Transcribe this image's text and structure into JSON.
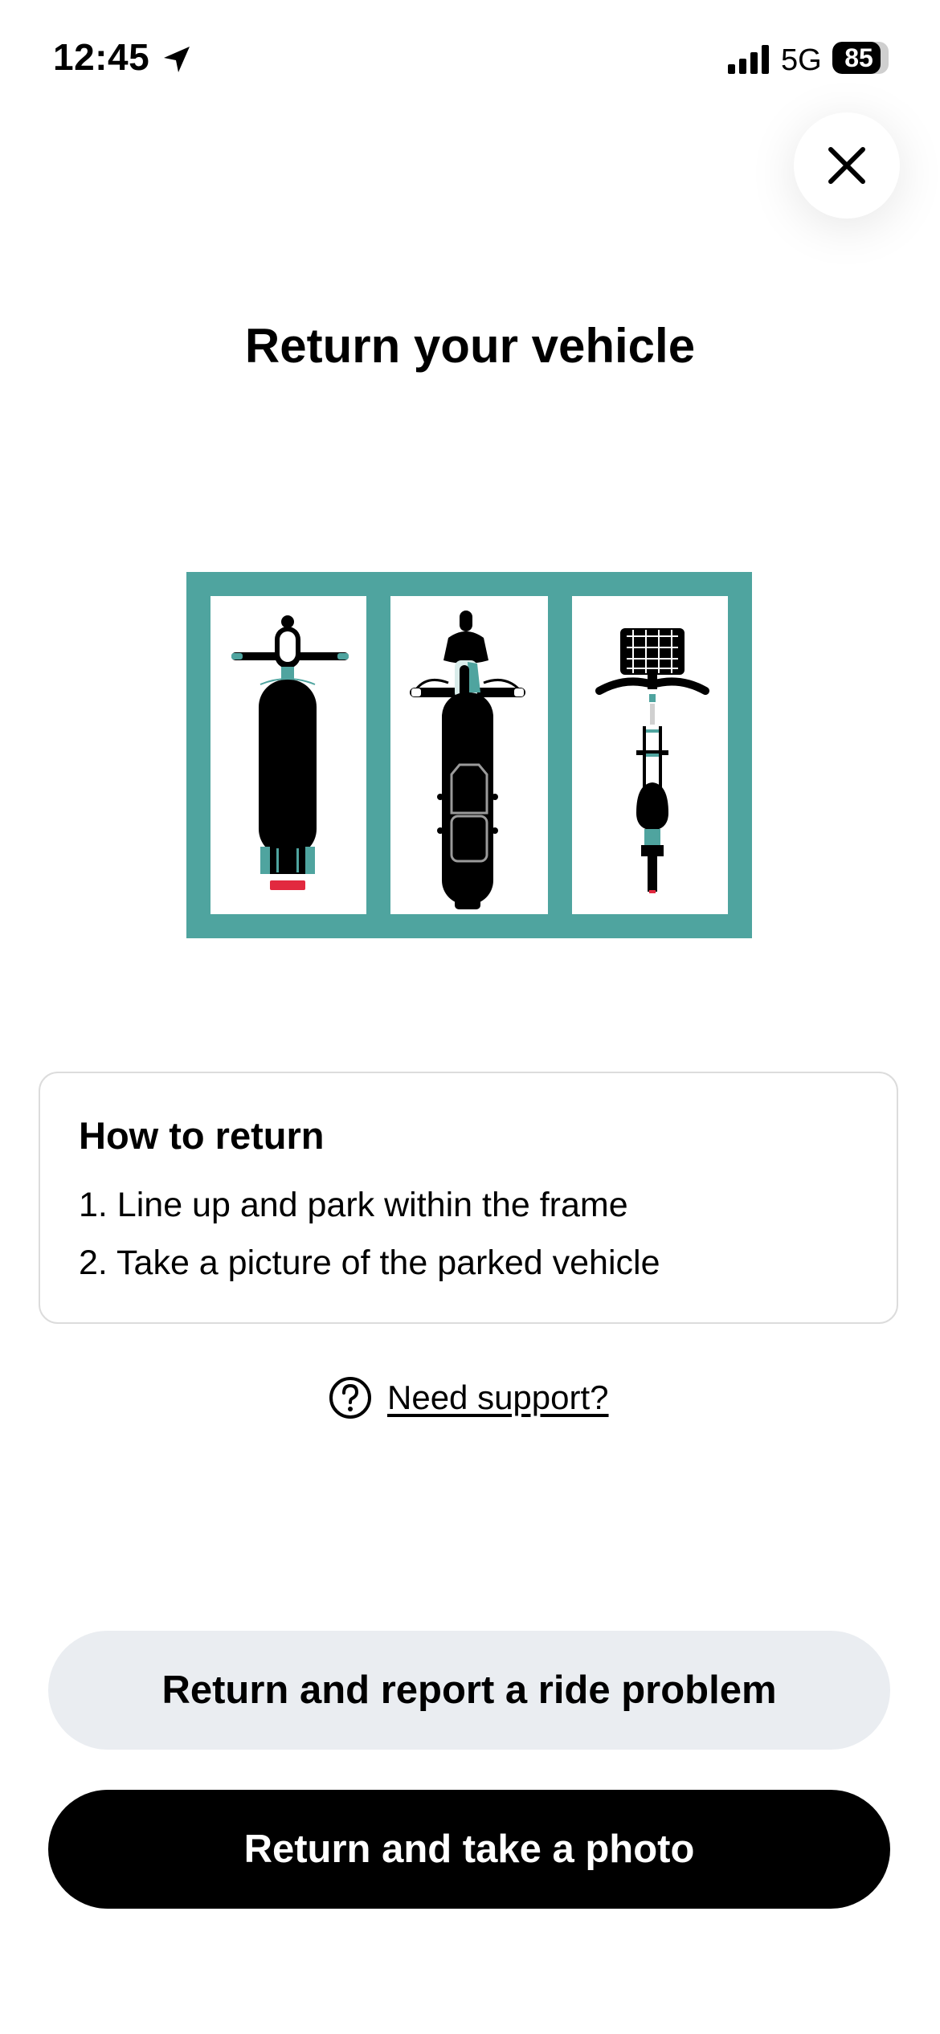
{
  "status_bar": {
    "time": "12:45",
    "network": "5G",
    "battery": "85",
    "battery_level": 0.85,
    "icons": [
      "location-arrow-icon",
      "cellular-signal-icon",
      "battery-icon"
    ]
  },
  "header": {
    "close_icon": "close-icon",
    "title": "Return your vehicle"
  },
  "illustration": {
    "frame_color": "#4fa49f",
    "vehicles": [
      "kick-scooter",
      "moped",
      "bike"
    ]
  },
  "how_to": {
    "title": "How to return",
    "steps": [
      "1. Line up and park within the frame",
      "2. Take a picture of the parked vehicle"
    ]
  },
  "support": {
    "icon": "question-circle-icon",
    "label": "Need support?"
  },
  "actions": {
    "report_label": "Return and report a ride problem",
    "photo_label": "Return and take a photo"
  },
  "colors": {
    "accent": "#4fa49f",
    "secondary_button": "#eaedf1",
    "primary_button": "#000000",
    "red_light": "#e2293f"
  }
}
